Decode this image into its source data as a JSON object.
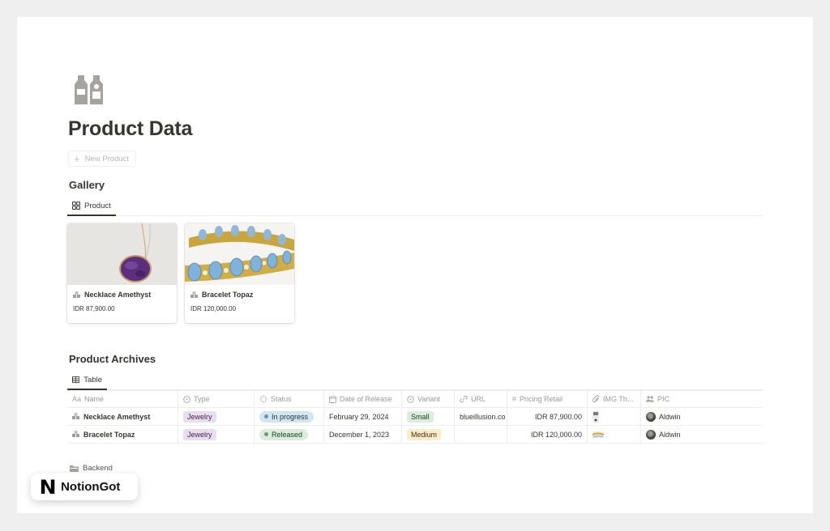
{
  "page": {
    "icon": "bottles-icon",
    "title": "Product Data",
    "new_button_label": "New Product"
  },
  "gallery": {
    "title": "Gallery",
    "tab_label": "Product",
    "tab_icon": "gallery-grid-icon",
    "cards": [
      {
        "name": "Necklace Amethyst",
        "price": "IDR 87,900.00",
        "image": "amethyst-necklace-photo"
      },
      {
        "name": "Bracelet Topaz",
        "price": "IDR 120,000.00",
        "image": "topaz-bracelet-photo"
      }
    ]
  },
  "archives": {
    "title": "Product Archives",
    "tab_label": "Table",
    "tab_icon": "table-icon",
    "columns": [
      {
        "label": "Name",
        "icon": "Aa"
      },
      {
        "label": "Type",
        "icon": "select-icon"
      },
      {
        "label": "Status",
        "icon": "status-icon"
      },
      {
        "label": "Date of Release",
        "icon": "calendar-icon"
      },
      {
        "label": "Variant",
        "icon": "select-icon"
      },
      {
        "label": "URL",
        "icon": "link-icon"
      },
      {
        "label": "Pricing Retail",
        "icon": "number-icon"
      },
      {
        "label": "IMG Th...",
        "icon": "attachment-icon"
      },
      {
        "label": "PIC",
        "icon": "people-icon"
      }
    ],
    "rows": [
      {
        "name": "Necklace Amethyst",
        "type": "Jewelry",
        "status": "In progress",
        "date": "February 29, 2024",
        "variant": "Small",
        "url": "blueillusion.co",
        "price": "IDR 87,900.00",
        "img": "necklace-thumbnail",
        "pic": "Aldwin"
      },
      {
        "name": "Bracelet Topaz",
        "type": "Jewelry",
        "status": "Released",
        "date": "December 1, 2023",
        "variant": "Medium",
        "url": "",
        "price": "IDR 120,000.00",
        "img": "bracelet-thumbnail",
        "pic": "Aldwin"
      }
    ]
  },
  "backend": {
    "label": "Backend",
    "icon": "folder-icon"
  },
  "badge": {
    "logo": "N",
    "text": "NotionGot"
  },
  "colors": {
    "type_tag_bg": "#e8deee",
    "type_tag_fg": "#412454",
    "status_in_progress_bg": "#d3e5ef",
    "status_in_progress_dot": "#5b97bd",
    "status_released_bg": "#dbeddb",
    "status_released_dot": "#6c9b7d",
    "variant_small_bg": "#dbeddb",
    "variant_medium_bg": "#fdecc8"
  }
}
